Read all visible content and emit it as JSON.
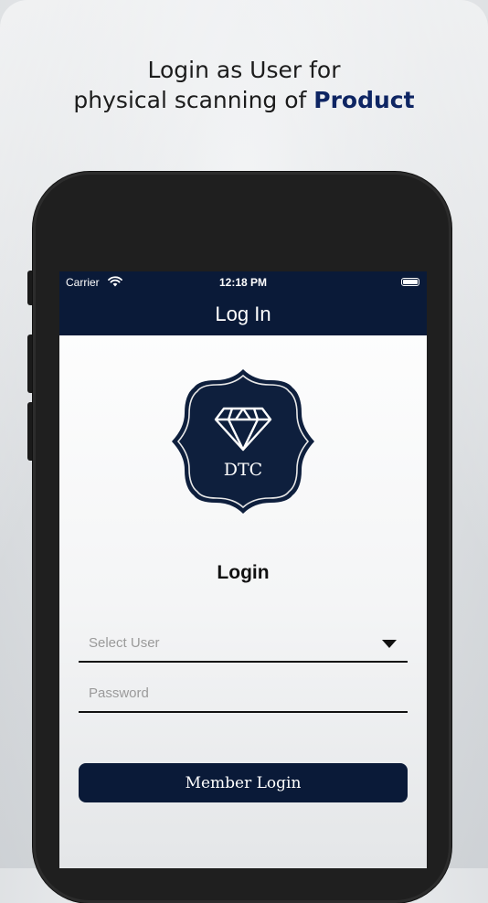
{
  "promo": {
    "line1": "Login as User for",
    "line2_prefix": "physical scanning of ",
    "line2_accent": "Product"
  },
  "status_bar": {
    "carrier": "Carrier",
    "time": "12:18 PM"
  },
  "nav": {
    "title": "Log In"
  },
  "logo": {
    "text": "DTC"
  },
  "form": {
    "heading": "Login",
    "select_user_placeholder": "Select User",
    "password_placeholder": "Password",
    "submit_label": "Member Login"
  },
  "colors": {
    "brand_navy": "#0a1a38",
    "accent_blue": "#0e2563"
  }
}
